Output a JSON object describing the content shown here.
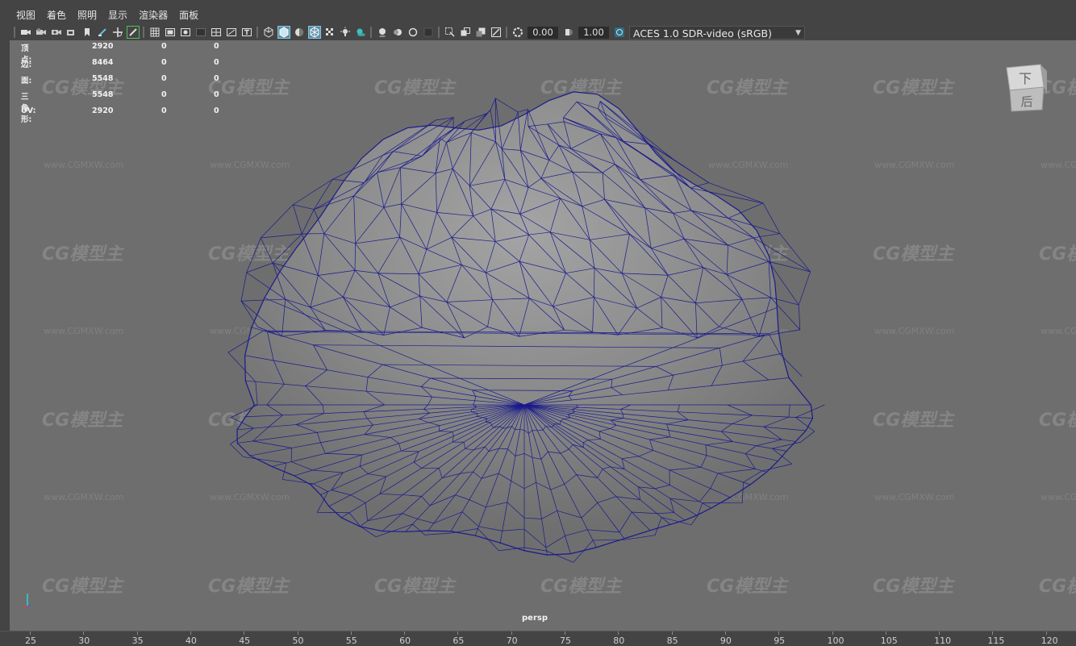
{
  "menubar": {
    "items": [
      "视图",
      "着色",
      "照明",
      "显示",
      "渲染器",
      "面板"
    ]
  },
  "toolbar": {
    "exposure_value": "0.00",
    "gamma_value": "1.00",
    "color_space": "ACES 1.0 SDR-video (sRGB)"
  },
  "hud": {
    "rows": [
      {
        "label": "顶点:",
        "v1": "2920",
        "v2": "0",
        "v3": "0"
      },
      {
        "label": "边:",
        "v1": "8464",
        "v2": "0",
        "v3": "0"
      },
      {
        "label": "面:",
        "v1": "5548",
        "v2": "0",
        "v3": "0"
      },
      {
        "label": "三角形:",
        "v1": "5548",
        "v2": "0",
        "v3": "0"
      },
      {
        "label": "UV:",
        "v1": "2920",
        "v2": "0",
        "v3": "0"
      }
    ]
  },
  "viewport": {
    "camera": "persp",
    "background_color": "#6e6e6e",
    "wire_color": "#1a1a8c"
  },
  "viewcube": {
    "top_label": "下",
    "front_label": "后"
  },
  "watermark": {
    "logo": "CG模型主",
    "url": "www.CGMXW.com"
  },
  "ruler": {
    "ticks": [
      "25",
      "30",
      "35",
      "40",
      "45",
      "50",
      "55",
      "60",
      "65",
      "70",
      "75",
      "80",
      "85",
      "90",
      "95",
      "100",
      "105",
      "110",
      "115",
      "120"
    ]
  }
}
